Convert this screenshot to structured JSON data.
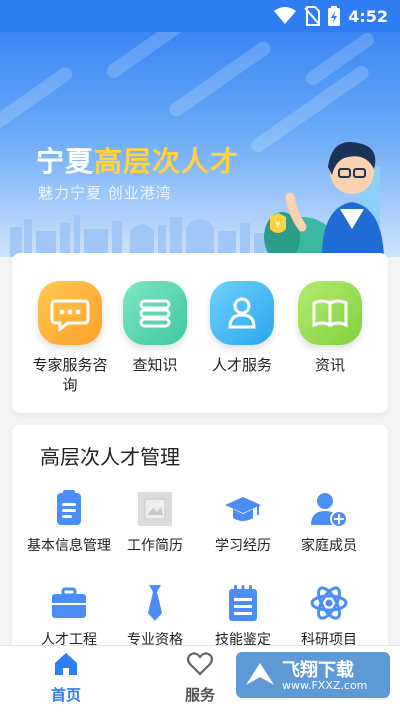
{
  "status": {
    "time": "4:52"
  },
  "banner": {
    "title_main": "宁夏",
    "title_accent": "高层次人才",
    "slogan": "魅力宁夏 创业港湾"
  },
  "services": [
    {
      "label": "专家服务咨询",
      "icon": "chat-icon"
    },
    {
      "label": "查知识",
      "icon": "stack-icon"
    },
    {
      "label": "人才服务",
      "icon": "person-icon"
    },
    {
      "label": "资讯",
      "icon": "book-icon"
    }
  ],
  "management": {
    "title": "高层次人才管理",
    "items": [
      {
        "label": "基本信息管理",
        "icon": "document-icon"
      },
      {
        "label": "工作简历",
        "icon": "image-placeholder-icon"
      },
      {
        "label": "学习经历",
        "icon": "graduation-cap-icon"
      },
      {
        "label": "家庭成员",
        "icon": "add-user-icon"
      },
      {
        "label": "人才工程",
        "icon": "briefcase-icon"
      },
      {
        "label": "专业资格",
        "icon": "tie-icon"
      },
      {
        "label": "技能鉴定",
        "icon": "notepad-icon"
      },
      {
        "label": "科研项目",
        "icon": "atom-icon"
      }
    ]
  },
  "nav": [
    {
      "label": "首页",
      "icon": "home-icon",
      "active": true
    },
    {
      "label": "服务",
      "icon": "heart-icon",
      "active": false
    }
  ],
  "watermark": {
    "brand": "飞翔下载",
    "url": "www.FXXZ.com"
  },
  "colors": {
    "primary": "#2f7df3",
    "accent": "#ffd23f"
  }
}
